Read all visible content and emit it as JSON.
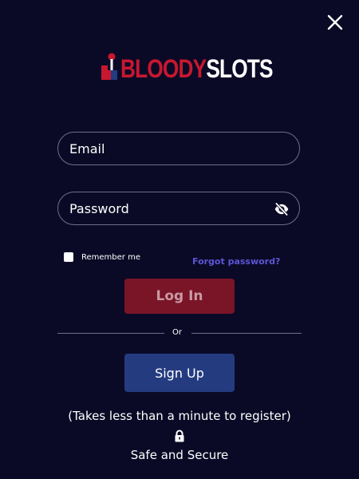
{
  "header": {
    "close_icon": "close-icon"
  },
  "logo": {
    "part1": "BLOODY",
    "part2": "SLOTS",
    "icon": "joystick-icon"
  },
  "form": {
    "email_placeholder": "Email",
    "email_value": "",
    "password_placeholder": "Password",
    "password_value": "",
    "password_toggle_icon": "eye-slash-icon",
    "remember_label": "Remember me",
    "remember_checked": false,
    "forgot_label": "Forgot password?",
    "login_label": "Log In"
  },
  "divider": {
    "label": "Or"
  },
  "signup": {
    "label": "Sign Up"
  },
  "footer": {
    "tagline": "(Takes less than a minute to register)",
    "lock_icon": "lock-icon",
    "secure_label": "Safe and Secure"
  },
  "colors": {
    "background": "#0b0a26",
    "brand_red": "#c8172f",
    "login_button": "#7a1427",
    "signup_button": "#243b80",
    "link": "#5d55d6"
  }
}
